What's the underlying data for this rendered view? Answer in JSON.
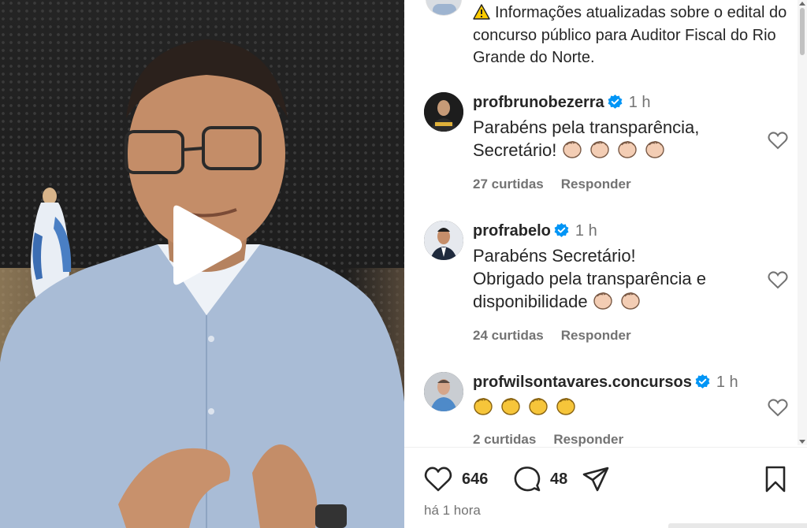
{
  "caption": {
    "text": "Informações atualizadas sobre o edital do concurso público para Auditor Fiscal do Rio Grande do Norte."
  },
  "comments": [
    {
      "username": "profbrunobezerra",
      "time": "1 h",
      "line1": "Parabéns pela transparência,",
      "line2": "Secretário!",
      "emoji_count": 4,
      "likes": "27 curtidas",
      "reply": "Responder"
    },
    {
      "username": "profrabelo",
      "time": "1 h",
      "line1": "Parabéns Secretário!",
      "line2": "Obrigado pela transparência e",
      "line3": "disponibilidade",
      "emoji_count": 2,
      "likes": "24 curtidas",
      "reply": "Responder"
    },
    {
      "username": "profwilsontavares.concursos",
      "time": "1 h",
      "emoji_count": 4,
      "likes": "2 curtidas",
      "reply": "Responder"
    }
  ],
  "actions": {
    "like_count": "646",
    "comment_count": "48"
  },
  "posted_time": "há 1 hora",
  "colors": {
    "verified": "#0095f6",
    "text": "#262626",
    "secondary": "#737373"
  },
  "icons": {
    "warning": "warning-icon",
    "verified": "verified-badge-icon",
    "like": "heart-icon",
    "comment": "comment-icon",
    "share": "share-icon",
    "save": "bookmark-icon",
    "play": "play-icon"
  }
}
